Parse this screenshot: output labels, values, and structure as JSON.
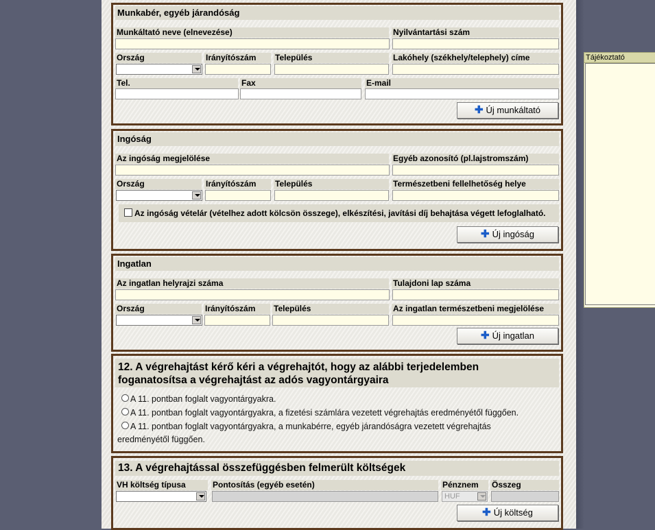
{
  "employer": {
    "title": "Munkabér, egyéb járandóság",
    "employer_name_label": "Munkáltató neve (elnevezése)",
    "registry_number_label": "Nyilvántartási szám",
    "country_label": "Ország",
    "zip_label": "Irányítószám",
    "city_label": "Település",
    "address_label": "Lakóhely (székhely/telephely) címe",
    "tel_label": "Tel.",
    "fax_label": "Fax",
    "email_label": "E-mail",
    "add_button": "Új munkáltató"
  },
  "movable": {
    "title": "Ingóság",
    "designation_label": "Az ingóság megjelölése",
    "other_id_label": "Egyéb azonosító (pl.lajstromszám)",
    "country_label": "Ország",
    "zip_label": "Irányítószám",
    "city_label": "Település",
    "location_label": "Természetbeni fellelhetőség helye",
    "checkbox_label": "Az ingóság vételár (vételhez adott kölcsön összege), elkészítési, javítási díj behajtása végett lefoglalható.",
    "add_button": "Új ingóság"
  },
  "realestate": {
    "title": "Ingatlan",
    "parcel_label": "Az ingatlan helyrajzi száma",
    "deed_label": "Tulajdoni lap száma",
    "country_label": "Ország",
    "zip_label": "Irányítószám",
    "city_label": "Település",
    "natural_label": "Az ingatlan természetbeni megjelölése",
    "add_button": "Új ingatlan"
  },
  "q12": {
    "title_line1": "12. A végrehajtást kérő kéri a végrehajtót, hogy az alábbi terjedelemben",
    "title_line2": "foganatosítsa a végrehajtást az adós vagyontárgyaira",
    "option1": "A 11. pontban foglalt vagyontárgyakra.",
    "option2": "A 11. pontban foglalt vagyontárgyakra, a fizetési számlára vezetett végrehajtás eredményétől függően.",
    "option3_line1": "A 11. pontban foglalt vagyontárgyakra, a munkabérre, egyéb járandóságra vezetett végrehajtás",
    "option3_line2": "eredményétől függően."
  },
  "q13": {
    "title": "13. A végrehajtással összefüggésben felmerült költségek",
    "cost_type_label": "VH költség típusa",
    "specification_label": "Pontosítás (egyéb esetén)",
    "currency_label": "Pénznem",
    "amount_label": "Összeg",
    "currency_value": "HUF",
    "add_button": "Új költség"
  },
  "info_panel": {
    "title": "Tájékoztató"
  }
}
